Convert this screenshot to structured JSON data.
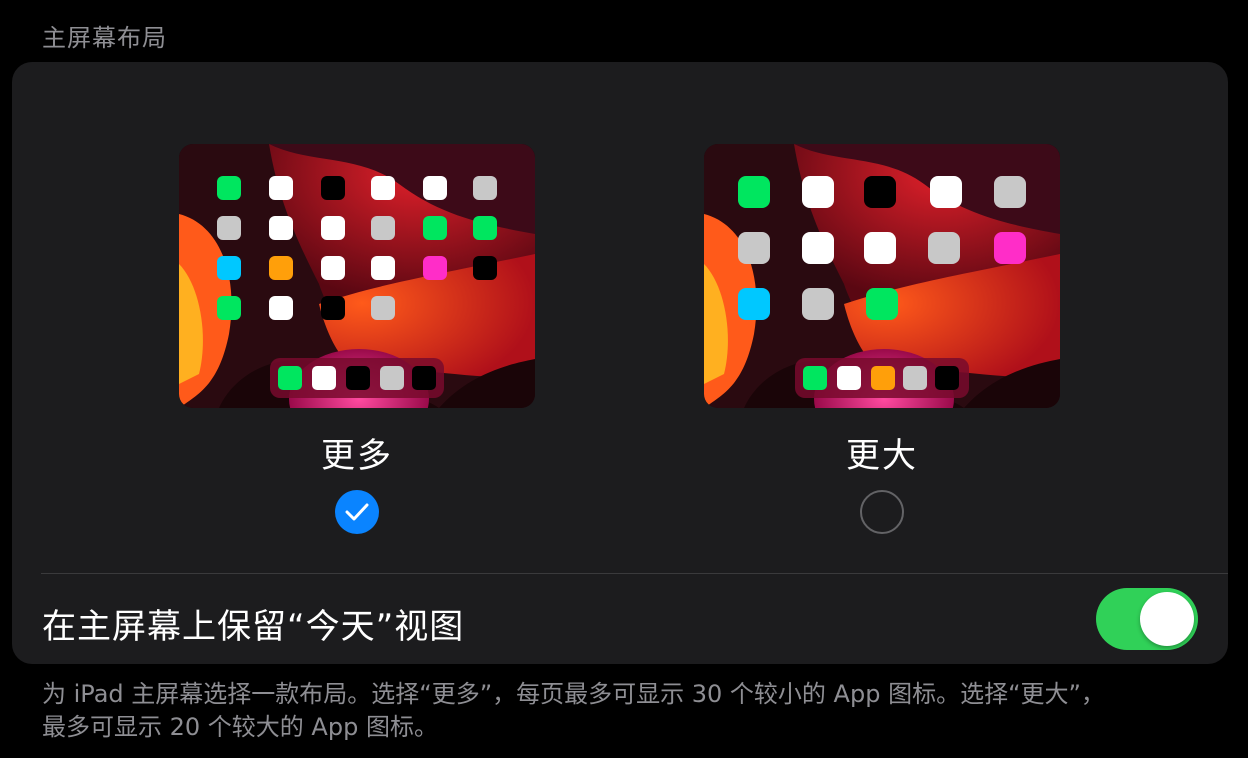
{
  "section": {
    "header": "主屏幕布局"
  },
  "options": [
    {
      "label": "更多",
      "selected": true,
      "grid_colors": [
        [
          "#00e65f",
          "#ffffff",
          "#000000",
          "#ffffff",
          "#ffffff",
          "#c8c8c8"
        ],
        [
          "#c8c8c8",
          "#ffffff",
          "#ffffff",
          "#c8c8c8",
          "#00e65f",
          "#00e65f"
        ],
        [
          "#00c8ff",
          "#ff9f0a",
          "#ffffff",
          "#ffffff",
          "#ff2dc8",
          "#000000"
        ],
        [
          "#00e65f",
          "#ffffff",
          "#000000",
          "#c8c8c8",
          "",
          ""
        ]
      ],
      "dock_colors": [
        "#00e65f",
        "#ffffff",
        "#000000",
        "#c8c8c8",
        "#000000"
      ]
    },
    {
      "label": "更大",
      "selected": false,
      "grid_colors": [
        [
          "#00e65f",
          "#ffffff",
          "#000000",
          "#ffffff",
          "#c8c8c8"
        ],
        [
          "#c8c8c8",
          "#ffffff",
          "#ffffff",
          "#c8c8c8",
          "#ff2dc8"
        ],
        [
          "#00c8ff",
          "#c8c8c8",
          "#00e65f",
          "",
          ""
        ]
      ],
      "dock_colors": [
        "#00e65f",
        "#ffffff",
        "#ff9f0a",
        "#c8c8c8",
        "#000000"
      ]
    }
  ],
  "toggle": {
    "label": "在主屏幕上保留“今天”视图",
    "on": true,
    "on_color": "#30d158"
  },
  "footer": {
    "line1": "为 iPad 主屏幕选择一款布局。选择“更多”，每页最多可显示 30 个较小的 App 图标。选择“更大”，",
    "line2": "最多可显示 20 个较大的 App 图标。"
  },
  "colors": {
    "accent": "#0a84ff",
    "card_bg": "#1c1c1e",
    "secondary_text": "#8e8e93"
  }
}
